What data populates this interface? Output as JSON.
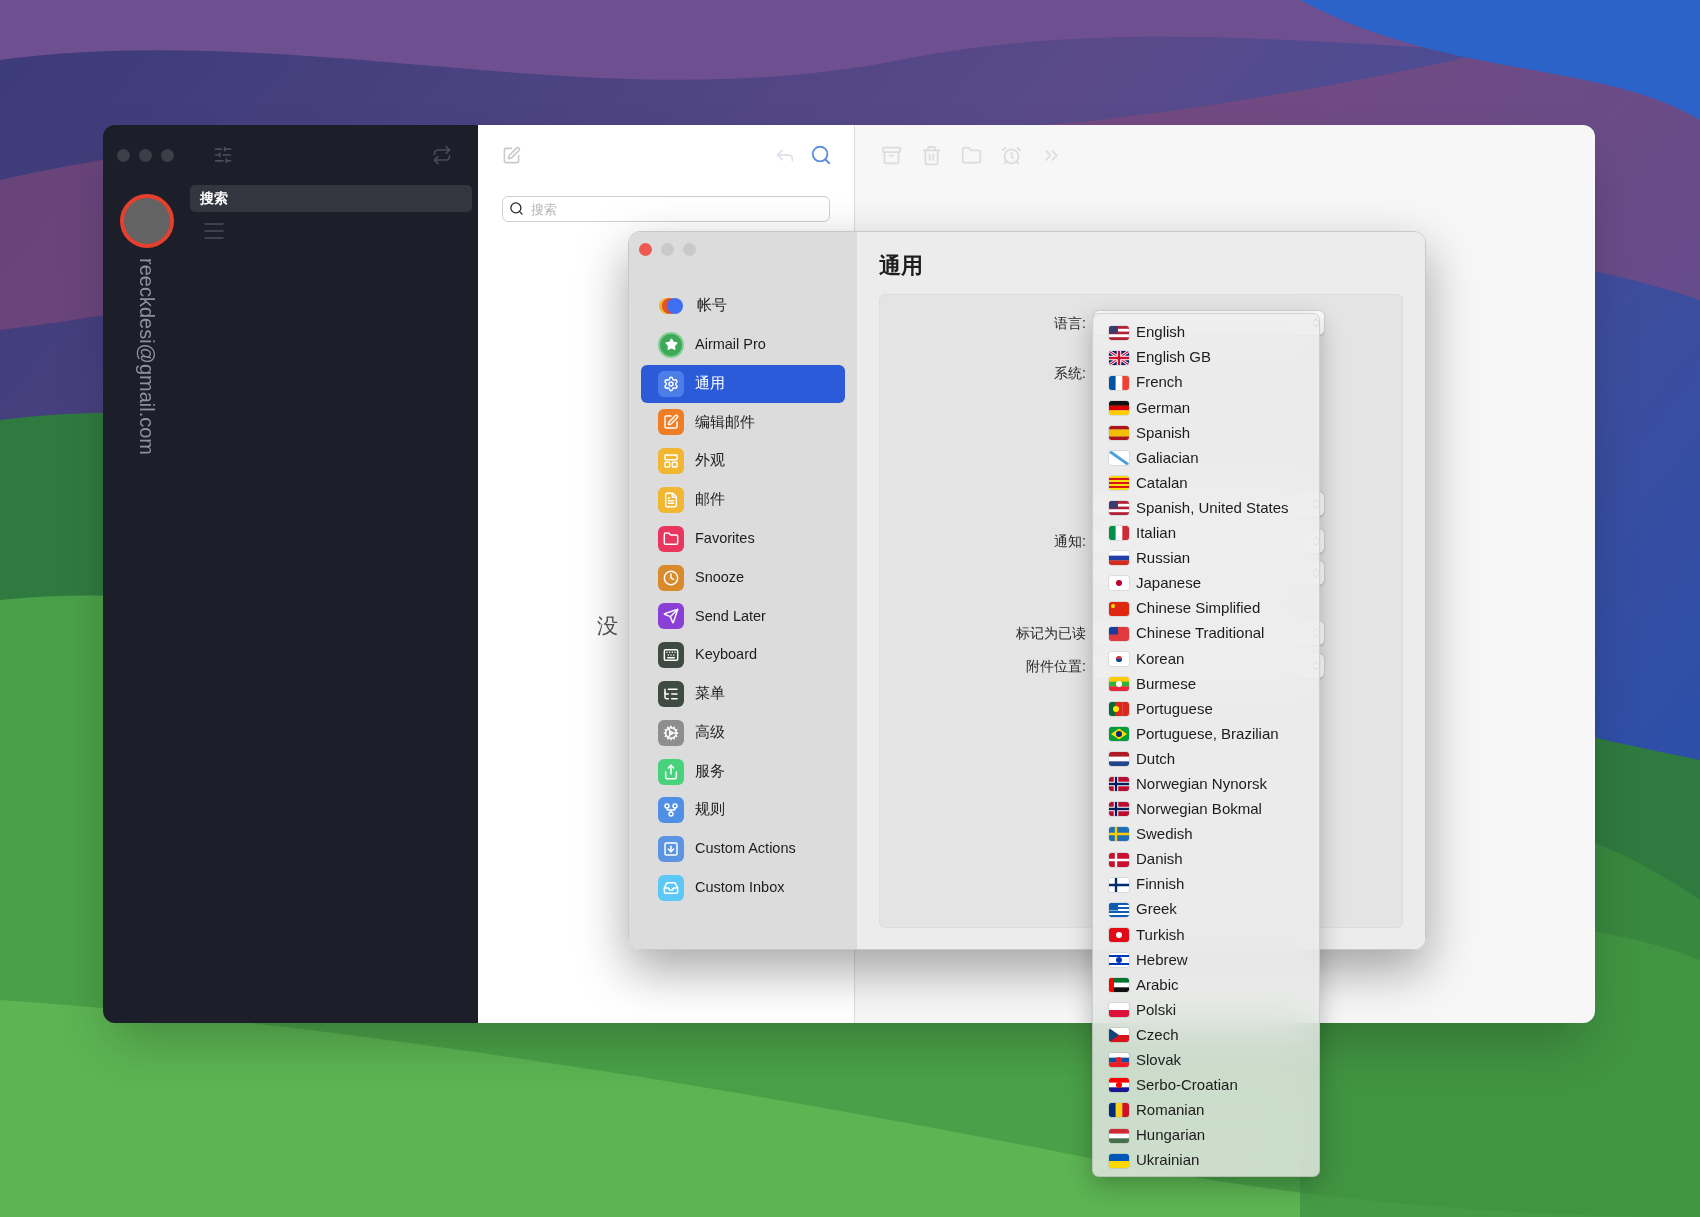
{
  "main_window": {
    "account_email": "reeckdesi@gmail.com",
    "mailboxes": [
      {
        "label": "搜索",
        "selected": true
      }
    ],
    "search": {
      "placeholder": "搜索"
    },
    "empty_text": "没"
  },
  "preferences": {
    "title": "通用",
    "sidebar": [
      {
        "label": "帐号",
        "kind": "accounts",
        "selected": false
      },
      {
        "label": "Airmail Pro",
        "kind": "pro",
        "selected": false
      },
      {
        "label": "通用",
        "kind": "gear",
        "selected": true
      },
      {
        "label": "编辑邮件",
        "kind": "compose",
        "selected": false
      },
      {
        "label": "外观",
        "kind": "layout",
        "selected": false
      },
      {
        "label": "邮件",
        "kind": "mail",
        "selected": false
      },
      {
        "label": "Favorites",
        "kind": "folder",
        "selected": false
      },
      {
        "label": "Snooze",
        "kind": "clock",
        "selected": false
      },
      {
        "label": "Send Later",
        "kind": "send",
        "selected": false
      },
      {
        "label": "Keyboard",
        "kind": "keyboard",
        "selected": false
      },
      {
        "label": "菜单",
        "kind": "menu",
        "selected": false
      },
      {
        "label": "高级",
        "kind": "gears",
        "selected": false
      },
      {
        "label": "服务",
        "kind": "share",
        "selected": false
      },
      {
        "label": "规则",
        "kind": "branch",
        "selected": false
      },
      {
        "label": "Custom Actions",
        "kind": "actions",
        "selected": false
      },
      {
        "label": "Custom Inbox",
        "kind": "inbox",
        "selected": false
      }
    ],
    "rows": [
      {
        "label": "语言:",
        "kind": "popup"
      },
      {
        "label": "系统:",
        "kind": "text"
      },
      {
        "kind": "popup"
      },
      {
        "label": "通知:",
        "kind": "popup"
      },
      {
        "kind": "popup"
      },
      {
        "label": "标记为已读",
        "kind": "popup"
      },
      {
        "label": "附件位置:",
        "kind": "popup"
      }
    ],
    "language_menu": [
      {
        "label": "English",
        "kind": "us"
      },
      {
        "label": "English GB",
        "kind": "gb"
      },
      {
        "label": "French",
        "kind": "fr"
      },
      {
        "label": "German",
        "kind": "de"
      },
      {
        "label": "Spanish",
        "kind": "es"
      },
      {
        "label": "Galiacian",
        "kind": "gl"
      },
      {
        "label": "Catalan",
        "kind": "ca"
      },
      {
        "label": "Spanish, United States",
        "kind": "us"
      },
      {
        "label": "Italian",
        "kind": "it"
      },
      {
        "label": "Russian",
        "kind": "ru"
      },
      {
        "label": "Japanese",
        "kind": "jp"
      },
      {
        "label": "Chinese Simplified",
        "kind": "cn"
      },
      {
        "label": "Chinese Traditional",
        "kind": "tw"
      },
      {
        "label": "Korean",
        "kind": "kr"
      },
      {
        "label": "Burmese",
        "kind": "mm"
      },
      {
        "label": "Portuguese",
        "kind": "pt"
      },
      {
        "label": "Portuguese, Brazilian",
        "kind": "br"
      },
      {
        "label": "Dutch",
        "kind": "nl"
      },
      {
        "label": "Norwegian Nynorsk",
        "kind": "no"
      },
      {
        "label": "Norwegian Bokmal",
        "kind": "no"
      },
      {
        "label": "Swedish",
        "kind": "se"
      },
      {
        "label": "Danish",
        "kind": "dk"
      },
      {
        "label": "Finnish",
        "kind": "fi"
      },
      {
        "label": "Greek",
        "kind": "gr"
      },
      {
        "label": "Turkish",
        "kind": "tr"
      },
      {
        "label": "Hebrew",
        "kind": "il"
      },
      {
        "label": "Arabic",
        "kind": "ae"
      },
      {
        "label": "Polski",
        "kind": "pl"
      },
      {
        "label": "Czech",
        "kind": "cz"
      },
      {
        "label": "Slovak",
        "kind": "sk"
      },
      {
        "label": "Serbo-Croatian",
        "kind": "hr"
      },
      {
        "label": "Romanian",
        "kind": "ro"
      },
      {
        "label": "Hungarian",
        "kind": "hu"
      },
      {
        "label": "Ukrainian",
        "kind": "ua"
      }
    ]
  }
}
